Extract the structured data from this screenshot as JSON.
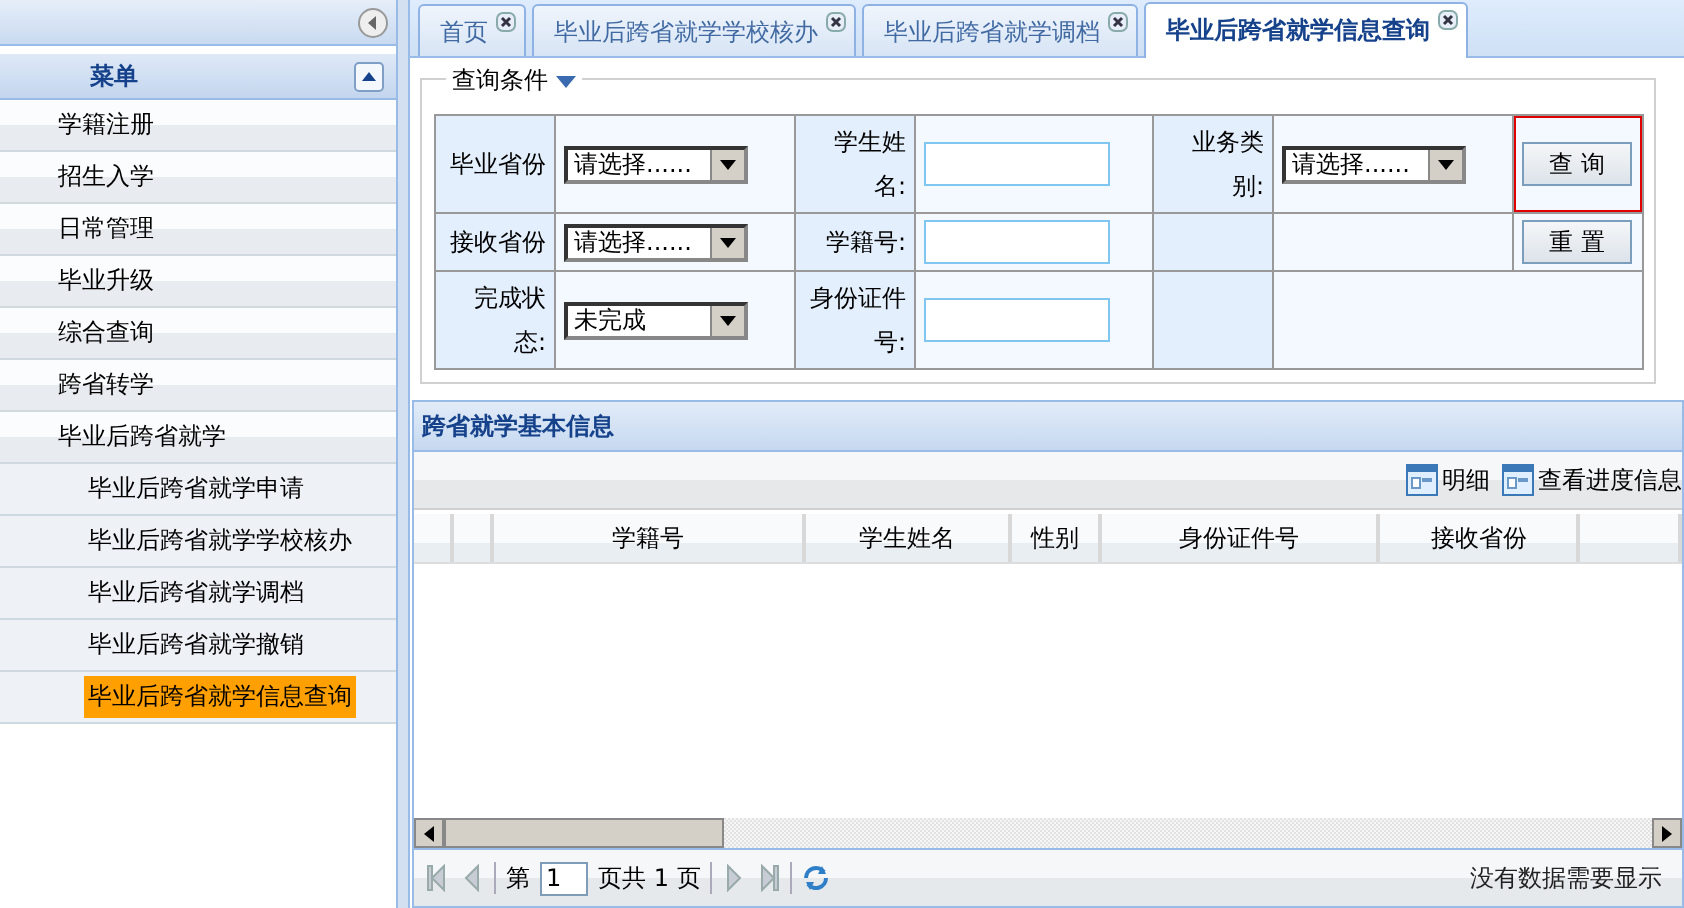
{
  "sidebar": {
    "menu_title": "菜单",
    "items": [
      {
        "label": "学籍注册",
        "selected": false
      },
      {
        "label": "招生入学",
        "selected": false
      },
      {
        "label": "日常管理",
        "selected": false
      },
      {
        "label": "毕业升级",
        "selected": false
      },
      {
        "label": "综合查询",
        "selected": false
      },
      {
        "label": "跨省转学",
        "selected": false
      },
      {
        "label": "毕业后跨省就学",
        "selected": false,
        "children": [
          {
            "label": "毕业后跨省就学申请",
            "selected": false
          },
          {
            "label": "毕业后跨省就学学校核办",
            "selected": false
          },
          {
            "label": "毕业后跨省就学调档",
            "selected": false
          },
          {
            "label": "毕业后跨省就学撤销",
            "selected": false
          },
          {
            "label": "毕业后跨省就学信息查询",
            "selected": true
          }
        ]
      }
    ]
  },
  "tabs": [
    {
      "label": "首页",
      "selected": false
    },
    {
      "label": "毕业后跨省就学学校核办",
      "selected": false
    },
    {
      "label": "毕业后跨省就学调档",
      "selected": false
    },
    {
      "label": "毕业后跨省就学信息查询",
      "selected": true
    }
  ],
  "query": {
    "legend": "查询条件",
    "rows": [
      {
        "cells": [
          {
            "kind": "label",
            "text": "毕业省份"
          },
          {
            "kind": "select",
            "value": "请选择......"
          },
          {
            "kind": "label",
            "text": "学生姓名:"
          },
          {
            "kind": "input"
          },
          {
            "kind": "label",
            "text": "业务类别:"
          },
          {
            "kind": "select",
            "value": "请选择......"
          },
          {
            "kind": "button",
            "text": "查 询",
            "highlighted": true
          }
        ]
      },
      {
        "cells": [
          {
            "kind": "label",
            "text": "接收省份"
          },
          {
            "kind": "select",
            "value": "请选择......"
          },
          {
            "kind": "label",
            "text": "学籍号:"
          },
          {
            "kind": "input"
          },
          {
            "kind": "empty_label"
          },
          {
            "kind": "empty"
          },
          {
            "kind": "button",
            "text": "重 置",
            "highlighted": false
          }
        ]
      },
      {
        "cells": [
          {
            "kind": "label",
            "text": "完成状态:"
          },
          {
            "kind": "select",
            "value": "未完成"
          },
          {
            "kind": "label",
            "text": "身份证件号:"
          },
          {
            "kind": "input"
          },
          {
            "kind": "empty_label"
          },
          {
            "kind": "empty_wide"
          }
        ]
      }
    ]
  },
  "grid": {
    "title": "跨省就学基本信息",
    "toolbar": [
      "明细",
      "查看进度信息"
    ],
    "columns": [
      "学籍号",
      "学生姓名",
      "性别",
      "身份证件号",
      "接收省份"
    ],
    "pager": {
      "prefix": "第",
      "page": "1",
      "suffix": "页共 1 页",
      "status": "没有数据需要显示"
    }
  }
}
